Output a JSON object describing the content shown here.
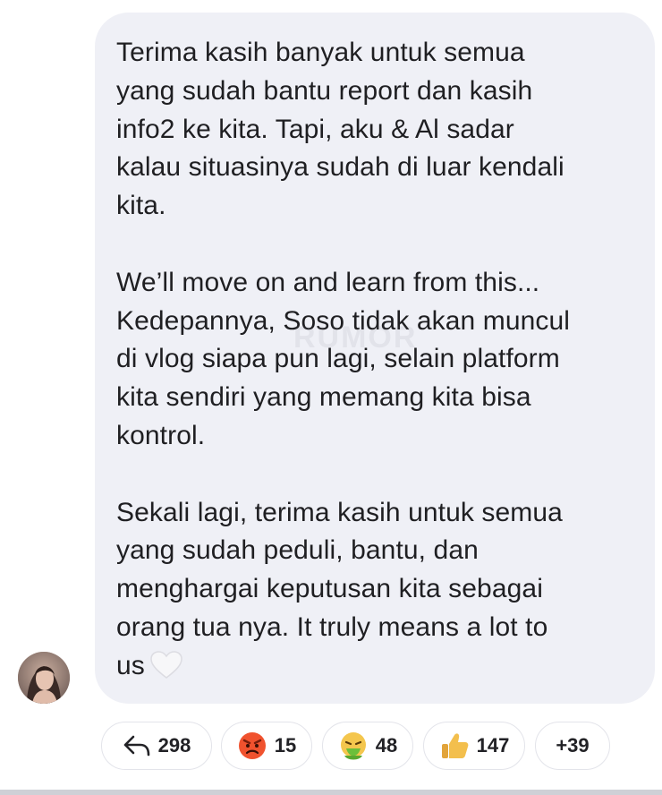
{
  "message": {
    "paragraphs": [
      {
        "lines": [
          "Terima kasih banyak untuk semua",
          "yang sudah bantu report dan kasih",
          "info2 ke kita. Tapi, aku & Al sadar",
          "kalau situasinya sudah di luar kendali",
          "kita."
        ]
      },
      {
        "lines": [
          "We’ll move on and learn from this...",
          "Kedepannya, Soso tidak akan muncul",
          "di vlog siapa pun lagi, selain platform",
          "kita sendiri yang memang kita bisa",
          "kontrol."
        ]
      },
      {
        "lines": [
          "Sekali lagi, terima kasih untuk semua",
          "yang sudah peduli, bantu, dan",
          "menghargai keputusan kita sebagai",
          "orang tua nya. It truly means a lot to",
          "us"
        ]
      }
    ],
    "trailing_icon": "white-heart-icon",
    "watermark": "RUMOR"
  },
  "sender": {
    "avatar_icon": "profile-photo"
  },
  "reactions": [
    {
      "icon": "reply-arrow-icon",
      "count": "298"
    },
    {
      "icon": "angry-face-icon",
      "count": "15"
    },
    {
      "icon": "nauseated-face-icon",
      "count": "48"
    },
    {
      "icon": "thumbs-up-icon",
      "count": "147"
    },
    {
      "icon": "",
      "count": "+39"
    }
  ],
  "colors": {
    "bubble": "#eff0f6",
    "text": "#1f1f22",
    "pill_border": "#e3e4ea"
  }
}
